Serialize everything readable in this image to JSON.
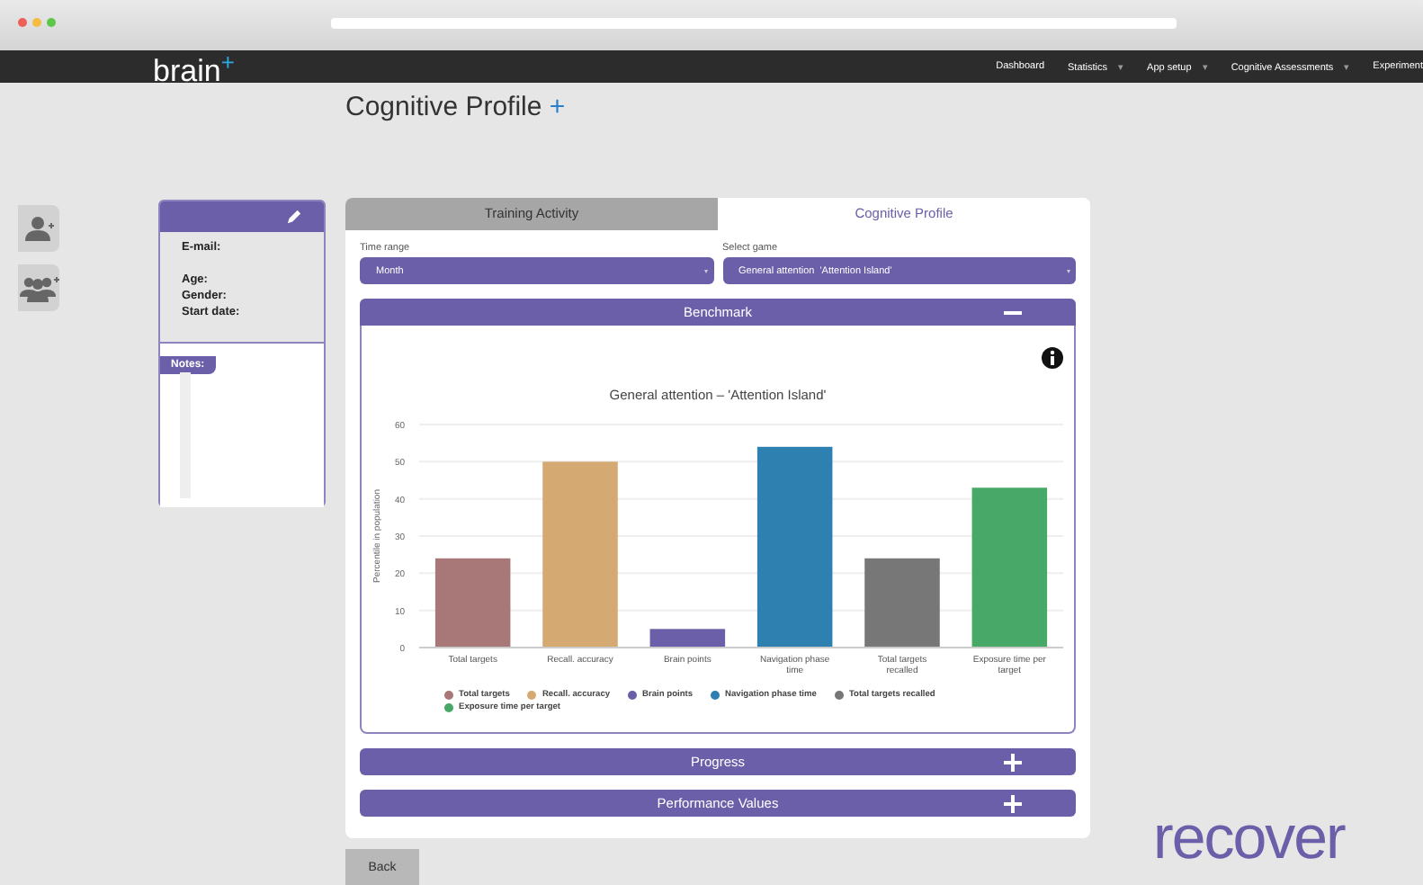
{
  "navbar": {
    "logo": "brain",
    "logo_mark": "+",
    "items": [
      {
        "label": "Dashboard"
      },
      {
        "label": "Statistics",
        "caret": "▾"
      },
      {
        "label": "App setup",
        "caret": "▾"
      },
      {
        "label": "Cognitive Assessments",
        "caret": "▾"
      },
      {
        "label": "Experiment"
      }
    ]
  },
  "page": {
    "title": "Cognitive Profile",
    "title_mark": "+"
  },
  "profile": {
    "fields": [
      "E-mail:",
      "Age:",
      "Gender:",
      "Start date:"
    ],
    "notes_label": "Notes:"
  },
  "tabs": [
    {
      "label": "Training Activity",
      "selected": false
    },
    {
      "label": "Cognitive Profile",
      "selected": true
    }
  ],
  "filters": [
    {
      "label": "Time range",
      "value": "Month",
      "caret": "▾"
    },
    {
      "label": "Select game",
      "value": "General attention  'Attention Island'",
      "caret": "▾"
    }
  ],
  "sections": [
    {
      "title": "Benchmark",
      "expanded": true
    },
    {
      "title": "Progress",
      "expanded": false
    },
    {
      "title": "Performance Values",
      "expanded": false
    }
  ],
  "chart_data": {
    "type": "bar",
    "title": "General attention – 'Attention Island'",
    "ylabel": "Percentile in population",
    "categories": [
      "Total targets",
      "Recall. accuracy",
      "Brain points",
      "Navigation phase time",
      "Total targets recalled",
      "Exposure time per target"
    ],
    "series": [
      {
        "name": "Total targets",
        "color": "#a87878",
        "values": [
          24,
          null,
          null,
          null,
          null,
          null
        ]
      },
      {
        "name": "Recall. accuracy",
        "color": "#d4aa72",
        "values": [
          null,
          50,
          null,
          null,
          null,
          null
        ]
      },
      {
        "name": "Brain points",
        "color": "#6a5fa8",
        "values": [
          null,
          null,
          5,
          null,
          null,
          null
        ]
      },
      {
        "name": "Navigation phase time",
        "color": "#2d80b0",
        "values": [
          null,
          null,
          null,
          54,
          null,
          null
        ]
      },
      {
        "name": "Total targets recalled",
        "color": "#777777",
        "values": [
          null,
          null,
          null,
          null,
          24,
          null
        ]
      },
      {
        "name": "Exposure time per target",
        "color": "#48a868",
        "values": [
          null,
          null,
          null,
          null,
          null,
          43
        ]
      }
    ],
    "ylim": [
      0,
      60
    ],
    "yticks": [
      0,
      10,
      20,
      30,
      40,
      50,
      60
    ],
    "grid": true
  },
  "back_button": "Back",
  "brand": "recover"
}
